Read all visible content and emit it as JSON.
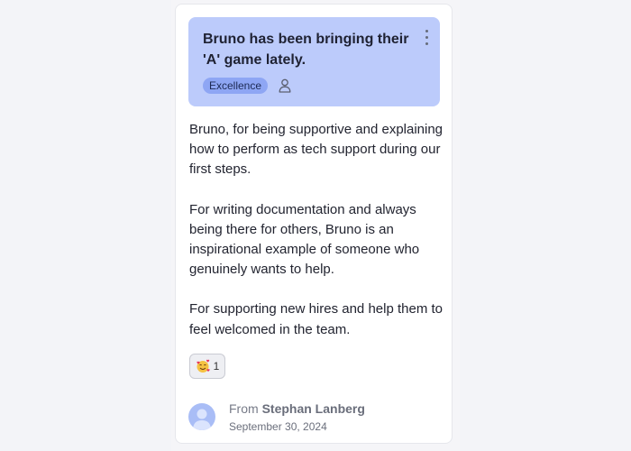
{
  "card": {
    "title": "Bruno has been bringing their\n'A' game lately.",
    "badge": "Excellence",
    "paragraphs": [
      "Bruno, for being supportive and explaining how to perform as tech support during our first steps.",
      "For writing documentation and always being there for others, Bruno is an inspirational example of someone who genuinely wants to help.",
      "For supporting new hires and help them to feel welcomed in the team."
    ],
    "reaction": {
      "emoji": "smiling-face-with-hearts-icon",
      "count": "1"
    },
    "from_prefix": "From",
    "from_name": "Stephan Lanberg",
    "date": "September 30, 2024"
  },
  "colors": {
    "header_bg": "#bccbfb",
    "badge_bg": "#8ea6f4",
    "avatar_bg": "#a9bdf6"
  }
}
